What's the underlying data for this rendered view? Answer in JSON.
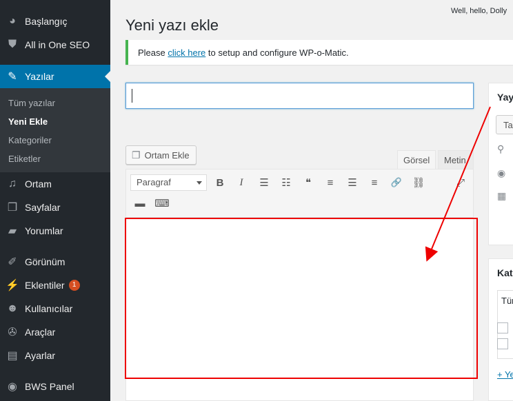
{
  "topbar": {
    "howdy": "Well, hello, Dolly"
  },
  "sidebar": {
    "items": [
      {
        "label": "Başlangıç",
        "icon": "dashboard-icon",
        "glyph": "◕"
      },
      {
        "label": "All in One SEO",
        "icon": "shield-icon",
        "glyph": "⛊"
      },
      {
        "label": "Yazılar",
        "icon": "pin-icon",
        "glyph": "✎",
        "active": true
      },
      {
        "label": "Ortam",
        "icon": "media-icon",
        "glyph": "♫"
      },
      {
        "label": "Sayfalar",
        "icon": "pages-icon",
        "glyph": "❐"
      },
      {
        "label": "Yorumlar",
        "icon": "comments-icon",
        "glyph": "▰"
      },
      {
        "label": "Görünüm",
        "icon": "appearance-icon",
        "glyph": "✐"
      },
      {
        "label": "Eklentiler",
        "icon": "plugins-icon",
        "glyph": "⚡",
        "badge": "1"
      },
      {
        "label": "Kullanıcılar",
        "icon": "users-icon",
        "glyph": "☻"
      },
      {
        "label": "Araçlar",
        "icon": "tools-icon",
        "glyph": "✇"
      },
      {
        "label": "Ayarlar",
        "icon": "settings-icon",
        "glyph": "▤"
      },
      {
        "label": "BWS Panel",
        "icon": "bws-icon",
        "glyph": "◉"
      }
    ],
    "submenu": [
      "Tüm yazılar",
      "Yeni Ekle",
      "Kategoriler",
      "Etiketler"
    ]
  },
  "page": {
    "title": "Yeni yazı ekle",
    "notice": {
      "before": "Please ",
      "link": "click here",
      "after": " to setup and configure WP-o-Matic."
    }
  },
  "editor": {
    "media_button": "Ortam Ekle",
    "tab_visual": "Görsel",
    "tab_text": "Metin",
    "format_value": "Paragraf",
    "toolbar_row1": [
      {
        "name": "bold-icon",
        "glyph": "B"
      },
      {
        "name": "italic-icon",
        "glyph": "I"
      },
      {
        "name": "bullet-list-icon",
        "glyph": "☰"
      },
      {
        "name": "numbered-list-icon",
        "glyph": "☷"
      },
      {
        "name": "blockquote-icon",
        "glyph": "❝"
      },
      {
        "name": "align-left-icon",
        "glyph": "≡"
      },
      {
        "name": "align-center-icon",
        "glyph": "☰"
      },
      {
        "name": "align-right-icon",
        "glyph": "≡"
      },
      {
        "name": "link-icon",
        "glyph": "🔗"
      },
      {
        "name": "unlink-icon",
        "glyph": "⛓"
      },
      {
        "name": "fullscreen-icon",
        "glyph": "⤢"
      }
    ],
    "toolbar_row2": [
      {
        "name": "read-more-icon",
        "glyph": "▬"
      },
      {
        "name": "keyboard-icon",
        "glyph": "⌨"
      }
    ]
  },
  "publish_box": {
    "title": "Yayımla",
    "draft_button": "Taslak"
  },
  "category_box": {
    "title": "Kategoriler",
    "tab_all": "Tüm kategoriler",
    "add_new": "+ Yeni kategori ekle"
  },
  "colors": {
    "sidebar": "#23282d",
    "active": "#0073aa",
    "highlight": "#ee0000",
    "notice": "#46b450"
  }
}
